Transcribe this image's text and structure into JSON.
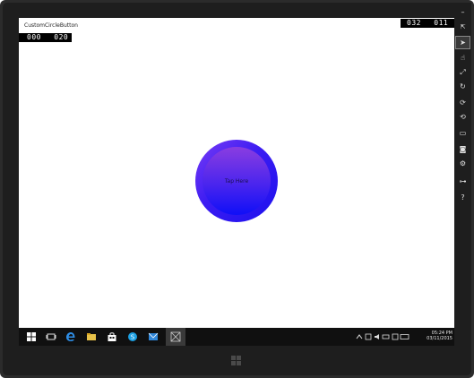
{
  "app": {
    "title": "CustomCircleButton"
  },
  "counters": {
    "left": [
      "000",
      "020"
    ],
    "right": [
      "032",
      "011"
    ]
  },
  "circle_button": {
    "label": "Tap Here",
    "colors": {
      "outer": "#3b1cf2",
      "inner_top": "#8a3de0",
      "inner_bottom": "#0f0ff7"
    }
  },
  "taskbar": {
    "icons": [
      "windows-start-icon",
      "task-view-icon",
      "edge-browser-icon",
      "file-explorer-icon",
      "store-icon",
      "skype-icon",
      "mail-icon",
      "simulator-app-icon"
    ],
    "tray_icons": [
      "chevron-up-icon",
      "network-icon",
      "volume-icon",
      "battery-icon",
      "action-center-icon",
      "keyboard-icon"
    ],
    "clock_time": "05:24 PM",
    "clock_date": "03/11/2015"
  },
  "side_toolbar": {
    "items": [
      "minimize-icon",
      "always-on-top-icon",
      "mouse-mode-icon",
      "touch-mode-icon",
      "pinch-zoom-icon",
      "rotate-touch-icon",
      "rotate-clockwise-icon",
      "rotate-counterclockwise-icon",
      "resolution-icon",
      "screenshot-icon",
      "settings-icon",
      "network-properties-icon",
      "help-icon"
    ]
  },
  "colors": {
    "bezel": "#2b2b2b",
    "taskbar": "#101010",
    "screen": "#ffffff"
  }
}
